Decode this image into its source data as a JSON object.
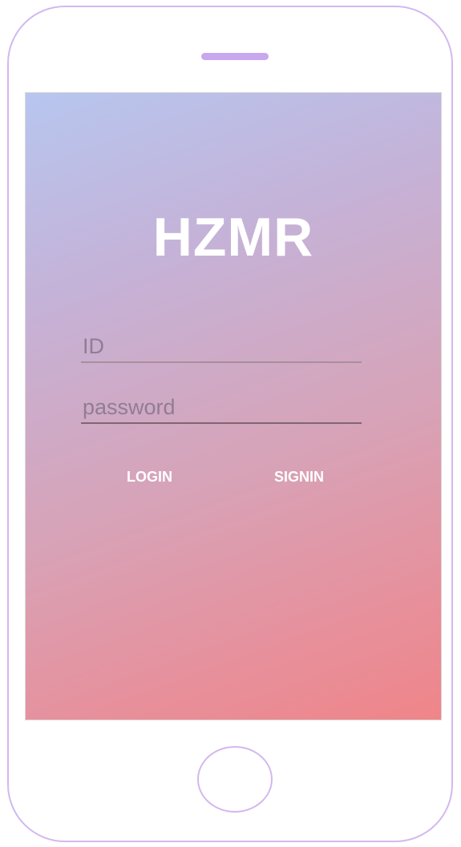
{
  "app": {
    "title": "HZMR"
  },
  "login_form": {
    "id_field": {
      "placeholder": "ID",
      "value": ""
    },
    "password_field": {
      "placeholder": "password",
      "value": ""
    },
    "login_label": "LOGIN",
    "signin_label": "SIGNIN"
  },
  "colors": {
    "frame": "#d3b8ef",
    "speaker": "#c9a7ee",
    "gradient_start": "#b7c6ef",
    "gradient_end": "#ef8589",
    "text_light": "#ffffff"
  },
  "icons": {
    "home_button": "home-button-icon",
    "speaker": "speaker-icon"
  }
}
